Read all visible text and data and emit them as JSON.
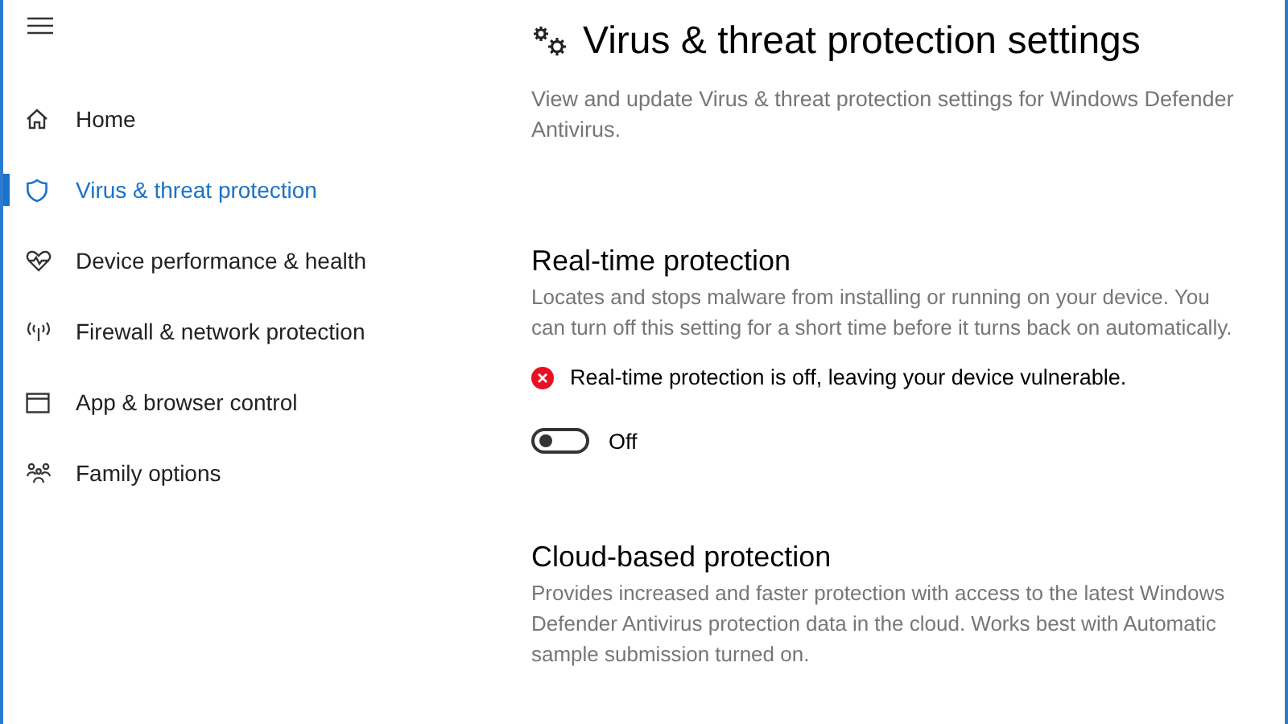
{
  "sidebar": {
    "items": [
      {
        "label": "Home",
        "kind": "home",
        "selected": false
      },
      {
        "label": "Virus & threat protection",
        "kind": "shield",
        "selected": true
      },
      {
        "label": "Device performance & health",
        "kind": "heart",
        "selected": false
      },
      {
        "label": "Firewall & network protection",
        "kind": "antenna",
        "selected": false
      },
      {
        "label": "App & browser control",
        "kind": "window",
        "selected": false
      },
      {
        "label": "Family options",
        "kind": "family",
        "selected": false
      }
    ]
  },
  "page": {
    "title": "Virus & threat protection settings",
    "description": "View and update Virus & threat protection settings for Windows Defender Antivirus."
  },
  "sections": [
    {
      "heading": "Real-time protection",
      "description": "Locates and stops malware from installing or running on your device. You can turn off this setting for a short time before it turns back on automatically.",
      "status": {
        "kind": "error",
        "text": "Real-time protection is off, leaving your device vulnerable."
      },
      "toggle": {
        "on": false,
        "label": "Off"
      }
    },
    {
      "heading": "Cloud-based protection",
      "description": "Provides increased and faster protection with access to the latest Windows Defender Antivirus protection data in the cloud. Works best with Automatic sample submission turned on."
    }
  ]
}
